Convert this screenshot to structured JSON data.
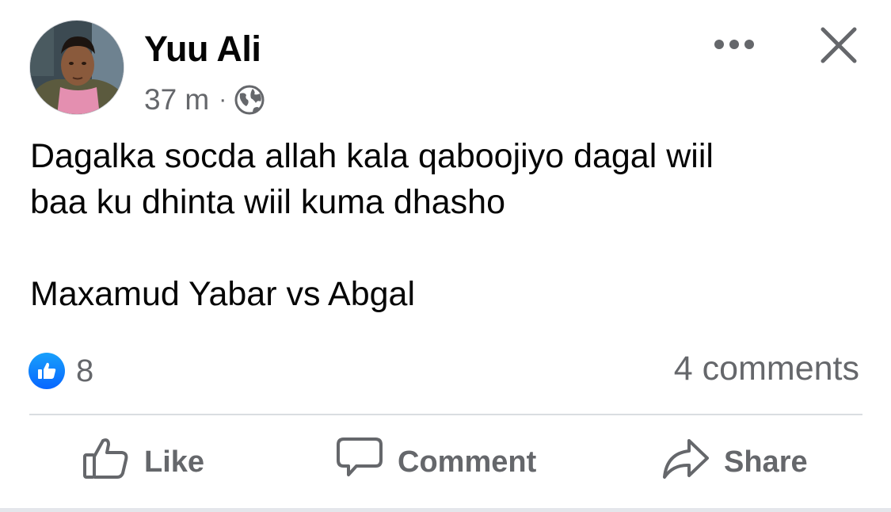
{
  "post": {
    "author": "Yuu Ali",
    "time": "37 m",
    "separator": "·",
    "audience_icon": "globe-icon",
    "text_lines": [
      "Dagalka socda allah kala qaboojiyo dagal wiil",
      "baa ku dhinta wiil kuma dhasho"
    ],
    "text_extra": "Maxamud Yabar vs Abgal"
  },
  "header_icons": {
    "more": "more-icon",
    "close": "close-icon"
  },
  "stats": {
    "reaction_icon": "like-reaction-icon",
    "reaction_count": "8",
    "comments": "4 comments"
  },
  "actions": {
    "like": "Like",
    "comment": "Comment",
    "share": "Share"
  },
  "colors": {
    "text": "#050505",
    "secondary": "#65676b",
    "like_blue": "#0866ff",
    "divider": "#dadde1"
  }
}
